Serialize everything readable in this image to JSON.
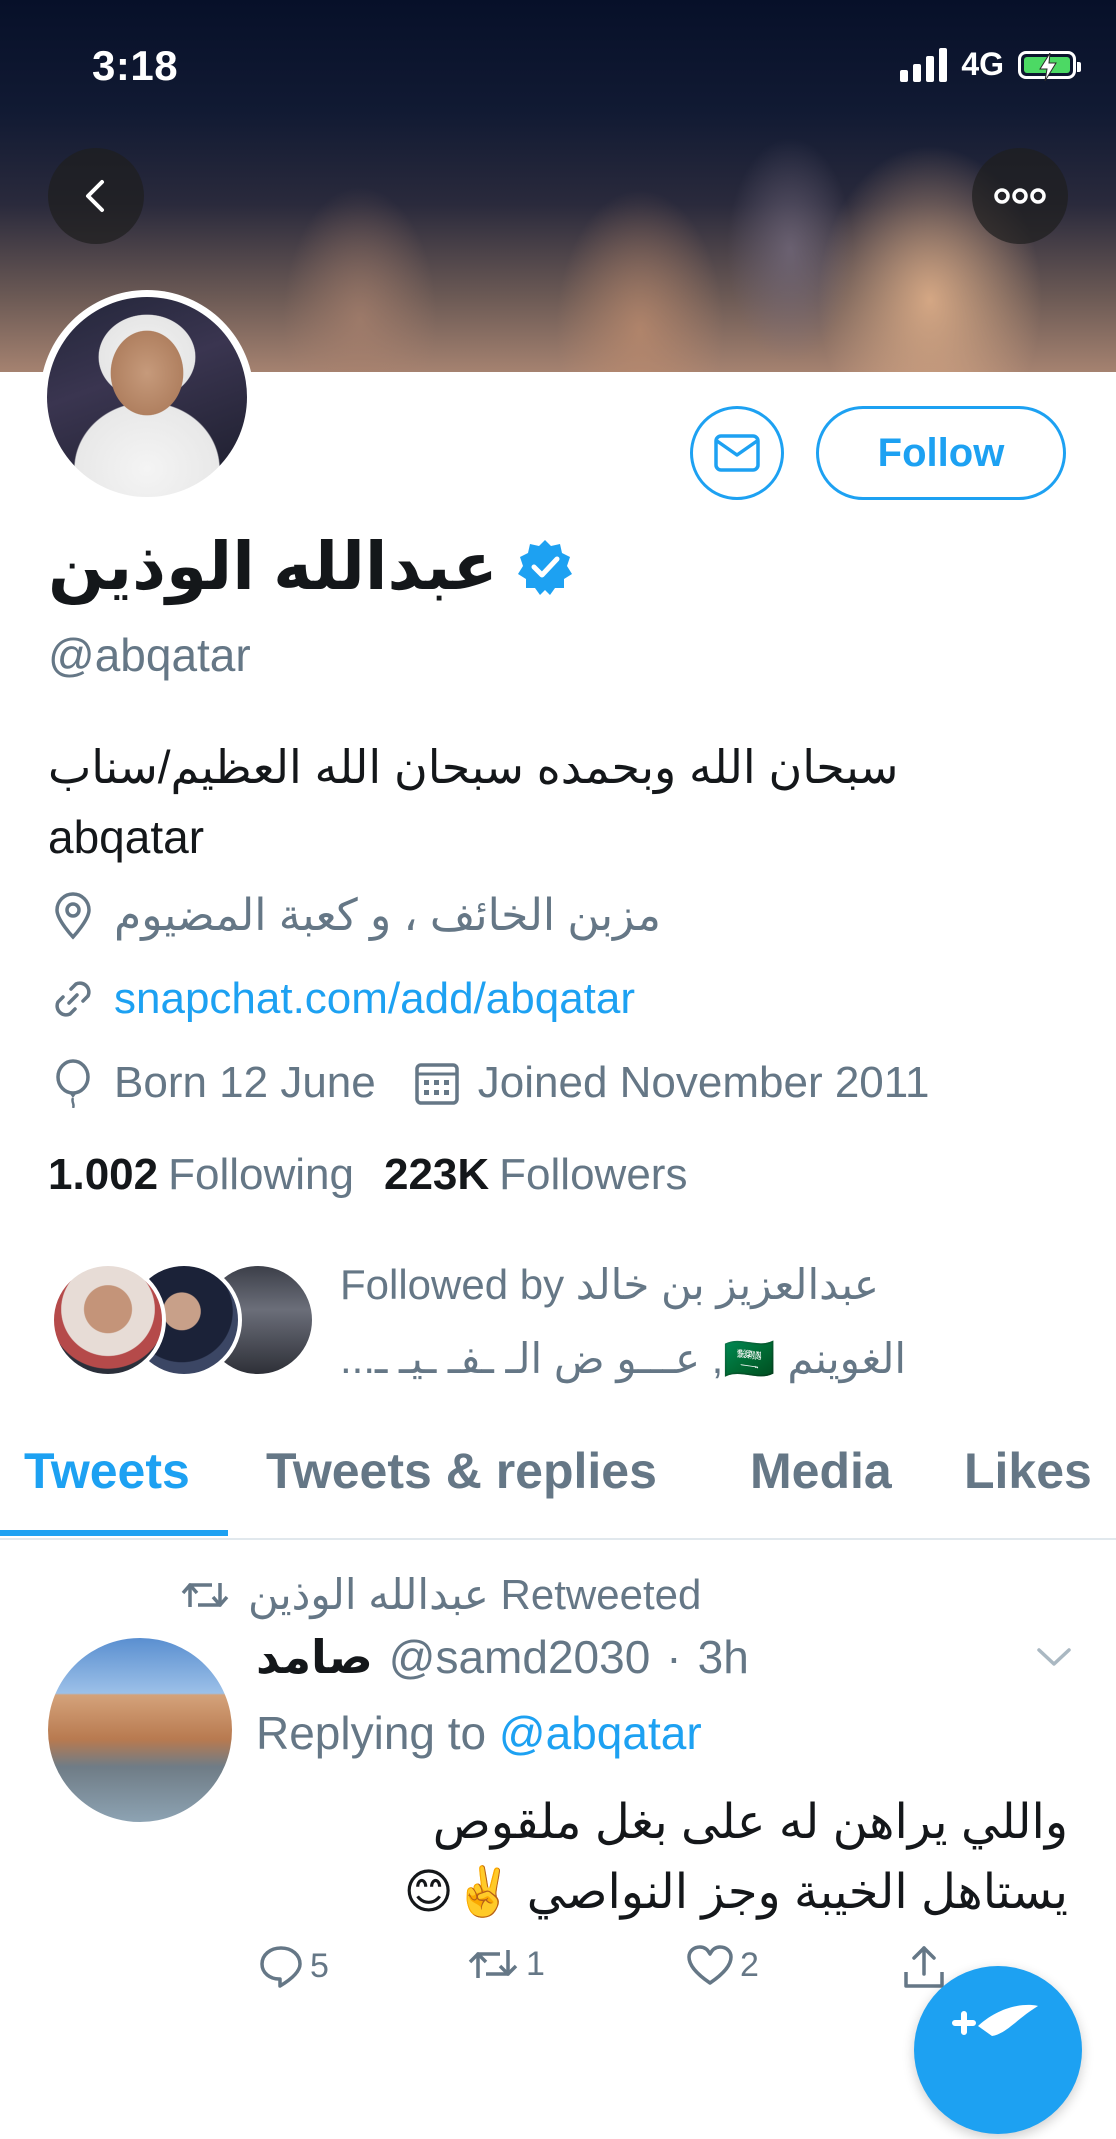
{
  "status_bar": {
    "time": "3:18",
    "network": "4G"
  },
  "colors": {
    "accent": "#1da1f2",
    "secondary_text": "#657786",
    "primary_text": "#14171a",
    "battery": "#4cd964"
  },
  "header": {
    "back_icon": "chevron-left-icon",
    "more_icon": "ellipsis-icon"
  },
  "profile": {
    "name": "عبدالله الوذين",
    "verified": true,
    "handle": "@abqatar",
    "follow_label": "Follow",
    "bio_line1": "سبحان الله وبحمده سبحان الله العظيم/سناب",
    "bio_line2": "abqatar",
    "location": "مزبن الخائف ، و كعبة المضيوم",
    "website": "snapchat.com/add/abqatar",
    "born": "Born 12 June",
    "joined": "Joined November 2011",
    "following_count": "1.002",
    "following_label": "Following",
    "followers_count": "223K",
    "followers_label": "Followers",
    "followed_by_line1": "Followed by عبدالعزيز بن خالد",
    "followed_by_line2": "الغوينم 🇸🇦, عـــو ض الـ ـفـ ـيـ ـ..."
  },
  "tabs": [
    {
      "label": "Tweets",
      "active": true
    },
    {
      "label": "Tweets & replies",
      "active": false
    },
    {
      "label": "Media",
      "active": false
    },
    {
      "label": "Likes",
      "active": false
    }
  ],
  "tweet": {
    "retweeted_by": "عبدالله الوذين Retweeted",
    "author_name": "صامد",
    "author_handle": "@samd2030",
    "separator": "·",
    "time": "3h",
    "replying_prefix": "Replying to ",
    "replying_handle": "@abqatar",
    "text_line1": "واللي يراهن له على بغل ملقوص",
    "text_line2": "يستاهل الخيبة وجز النواصي ✌️😊",
    "reply_count": "5",
    "retweet_count": "1",
    "like_count": "2"
  }
}
